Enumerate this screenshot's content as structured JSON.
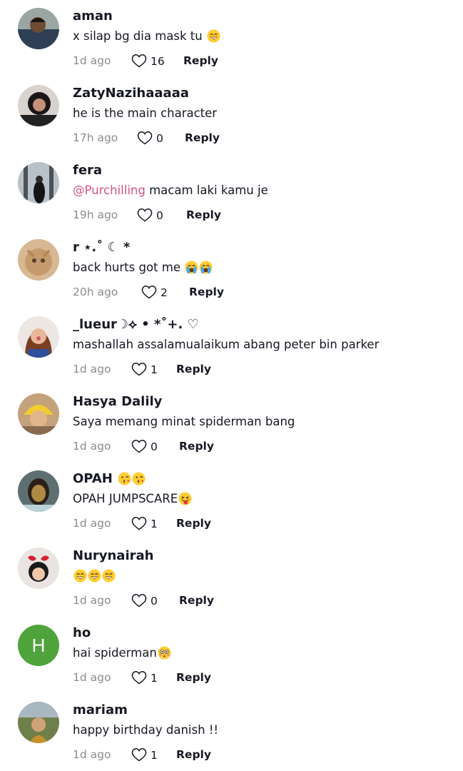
{
  "comments": [
    {
      "username": "aman",
      "text": "x silap bg dia mask tu ",
      "emojis": [
        "laughing"
      ],
      "time": "1d ago",
      "likes": "16",
      "reply": "Reply"
    },
    {
      "username": "ZatyNazihaaaaa",
      "text": "he is the main character",
      "emojis": [],
      "time": "17h ago",
      "likes": "0",
      "reply": "Reply"
    },
    {
      "username": "fera",
      "mention": "@Purchilling",
      "text": " macam laki kamu je",
      "emojis": [],
      "time": "19h ago",
      "likes": "0",
      "reply": "Reply"
    },
    {
      "username": "r ⋆.˚ ☾ *",
      "text": "back hurts got me ",
      "emojis": [
        "crying",
        "crying"
      ],
      "time": "20h ago",
      "likes": "2",
      "reply": "Reply"
    },
    {
      "username": "_lueur☽⟡ • *˚+. ♡",
      "text": "mashallah assalamualaikum abang peter bin parker",
      "emojis": [],
      "time": "1d ago",
      "likes": "1",
      "reply": "Reply"
    },
    {
      "username": "Hasya Dalily",
      "text": "Saya memang minat spiderman bang",
      "emojis": [],
      "time": "1d ago",
      "likes": "0",
      "reply": "Reply"
    },
    {
      "username": "OPAH ",
      "text": "OPAH JUMPSCARE",
      "emojis": [
        "tongue"
      ],
      "name_emojis": [
        "kiss",
        "kiss"
      ],
      "time": "1d ago",
      "likes": "1",
      "reply": "Reply"
    },
    {
      "username": "Nurynairah",
      "text": "",
      "emojis": [
        "laughing",
        "laughing",
        "laughing"
      ],
      "time": "1d ago",
      "likes": "0",
      "reply": "Reply"
    },
    {
      "username": "ho",
      "text": "hai spiderman",
      "emojis": [
        "flushed"
      ],
      "time": "1d ago",
      "likes": "1",
      "reply": "Reply",
      "avatar_letter": "H"
    },
    {
      "username": "mariam",
      "text": "happy birthday danish !!",
      "emojis": [],
      "time": "1d ago",
      "likes": "1",
      "reply": "Reply"
    }
  ],
  "colors": {
    "mention": "#d4557e",
    "time": "#8a8b91",
    "letter_avatar": "#4fa33b"
  }
}
